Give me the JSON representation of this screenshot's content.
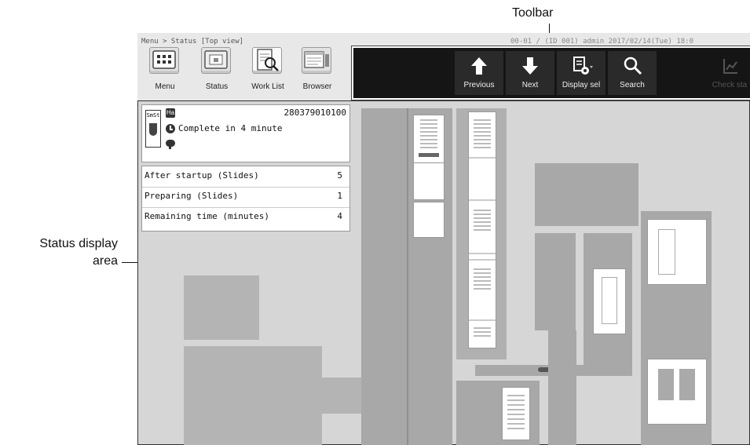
{
  "callouts": {
    "toolbar": "Toolbar",
    "status_display_line1": "Status display",
    "status_display_line2": "area"
  },
  "header": {
    "breadcrumb": "Menu > Status [Top view]",
    "session_info": "00-01 / (ID 001) admin 2017/02/14(Tue) 18:0"
  },
  "nav": {
    "menu": {
      "label": "Menu",
      "icon": "grid-icon"
    },
    "status": {
      "label": "Status",
      "icon": "status-monitor-icon"
    },
    "worklist": {
      "label": "Work List",
      "icon": "worklist-search-icon"
    },
    "browser": {
      "label": "Browser",
      "icon": "browser-icon"
    }
  },
  "toolbar": {
    "previous": {
      "label": "Previous",
      "icon": "arrow-up-icon"
    },
    "next": {
      "label": "Next",
      "icon": "arrow-down-icon"
    },
    "display_sel": {
      "label": "Display sel",
      "icon": "display-settings-icon"
    },
    "search": {
      "label": "Search",
      "icon": "magnifier-icon"
    },
    "check_status": {
      "label": "Check sta",
      "icon": "check-status-icon",
      "enabled": false
    }
  },
  "info": {
    "badge": "Ha",
    "instrument_label": "SmSt",
    "id_number": "280379010100",
    "status_text": "Complete in   4 minute"
  },
  "counts": [
    {
      "label": "After startup (Slides)",
      "value": "5"
    },
    {
      "label": "Preparing (Slides)",
      "value": "1"
    },
    {
      "label": "Remaining time (minutes)",
      "value": "4"
    }
  ],
  "colors": {
    "toolbar_bg": "#151515",
    "status_bg": "#d6d6d6",
    "module_dark": "#a8a8a8",
    "module_mid": "#b4b4b4"
  }
}
